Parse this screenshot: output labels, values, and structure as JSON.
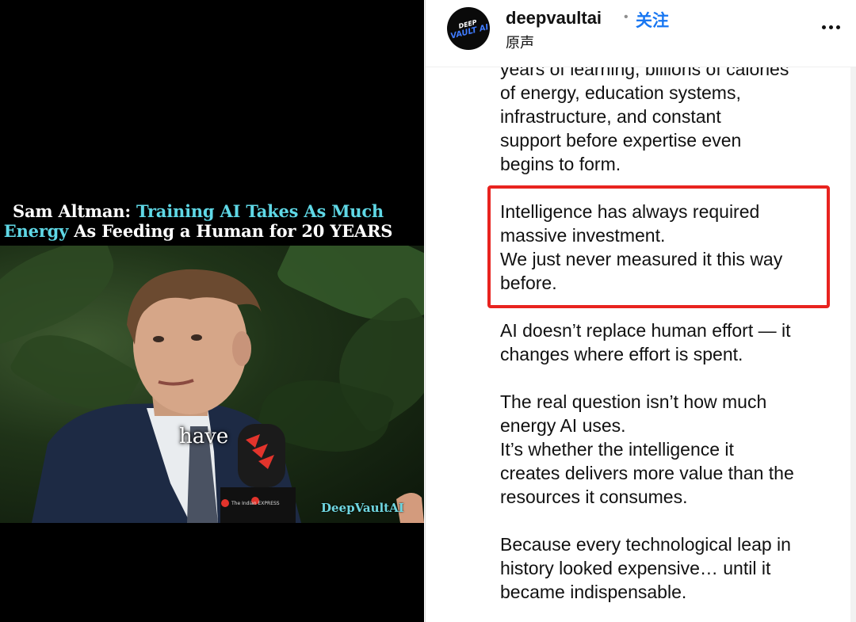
{
  "video": {
    "title_lines": [
      {
        "white_a": "Sam Altman: ",
        "cyan_a": "Training AI Takes As Much"
      },
      {
        "cyan_b": "Energy",
        "white_b": " As Feeding a Human for 20 YEARS"
      }
    ],
    "subtitle_word": "have",
    "watermark": "DeepVaultAI",
    "mic_label": "The Indian EXPRESS"
  },
  "post": {
    "avatar_text_top": "DEEP",
    "avatar_text": "VAULT AI",
    "username": "deepvaultai",
    "separator": "•",
    "follow_label": "关注",
    "audio_label": "原声"
  },
  "caption": {
    "para1": [
      "years of learning, billions of calories",
      "of energy, education systems,",
      "infrastructure, and constant",
      "support before expertise even",
      "begins to form."
    ],
    "para2": [
      "Intelligence has always required",
      "massive investment.",
      "We just never measured it this way",
      "before."
    ],
    "para3": [
      "AI doesn’t replace human effort — it",
      "changes where effort is spent."
    ],
    "para4": [
      "The real question isn’t how much",
      "energy AI uses.",
      "It’s whether the intelligence it",
      "creates delivers more value than the",
      "resources it consumes."
    ],
    "para5": [
      "Because every technological leap in",
      "history looked expensive… until it",
      "became indispensable."
    ]
  },
  "colors": {
    "highlight_border": "#e8231f",
    "follow": "#1877f2",
    "title_cyan": "#5fd8e6"
  }
}
